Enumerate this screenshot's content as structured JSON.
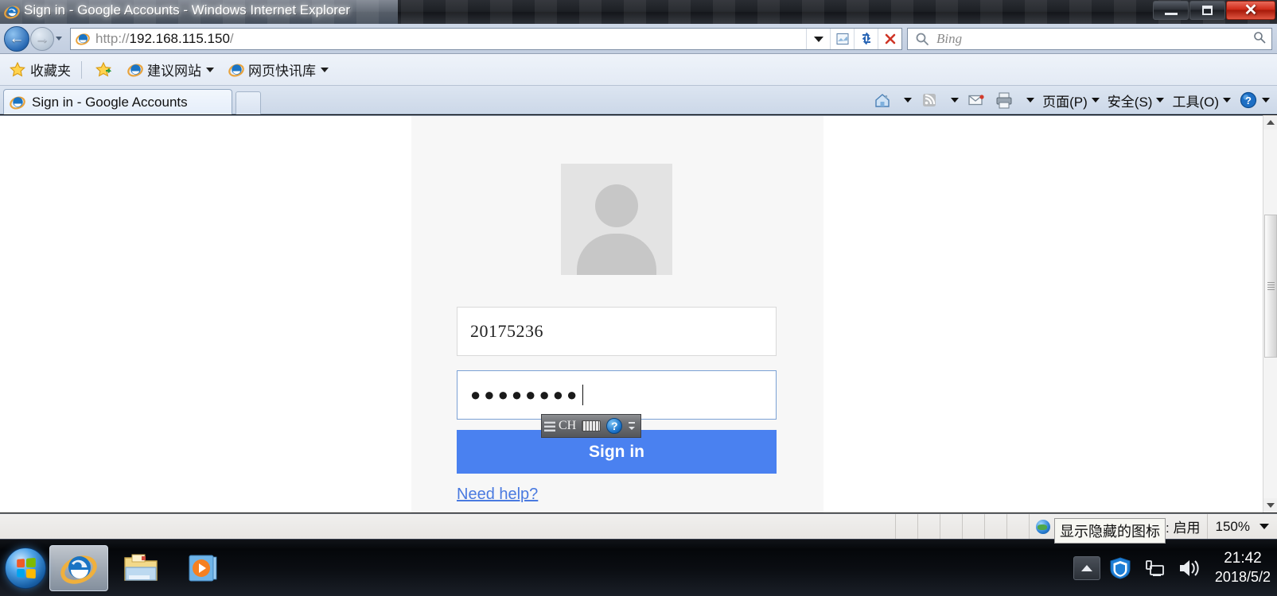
{
  "window": {
    "title": "Sign in - Google Accounts - Windows Internet Explorer",
    "minimize_label": "",
    "maximize_label": "",
    "close_label": "✕"
  },
  "navbar": {
    "back_label": "←",
    "forward_label": "→",
    "url_protocol": "http://",
    "url_host": "192.168.115.150",
    "url_trail": "/",
    "search_placeholder": "Bing",
    "compat_icon": "compatibility-view-icon",
    "refresh_icon": "refresh-icon",
    "stop_icon": "stop-icon"
  },
  "favorites_bar": {
    "favorites_label": "收藏夹",
    "items": [
      {
        "label": "建议网站",
        "has_caret": true
      },
      {
        "label": "网页快讯库",
        "has_caret": true
      }
    ]
  },
  "tabs": {
    "active_tab_label": "Sign in - Google Accounts",
    "new_tab_label": ""
  },
  "command_bar": {
    "items": [
      {
        "label": "",
        "icon": "home-icon",
        "caret": true
      },
      {
        "label": "",
        "icon": "rss-feed-icon",
        "caret": true
      },
      {
        "label": "",
        "icon": "mail-icon",
        "caret": false
      },
      {
        "label": "",
        "icon": "printer-icon",
        "caret": true
      },
      {
        "label": "页面(P)",
        "icon": "",
        "caret": true
      },
      {
        "label": "安全(S)",
        "icon": "",
        "caret": true
      },
      {
        "label": "工具(O)",
        "icon": "",
        "caret": true
      },
      {
        "label": "",
        "icon": "help-icon",
        "caret": true
      }
    ]
  },
  "page": {
    "avatar_alt": "default-user-avatar",
    "username_value": "20175236",
    "username_placeholder": "",
    "password_value": "●●●●●●●●",
    "password_placeholder": "",
    "signin_label": "Sign in",
    "need_help_label": "Need help?",
    "accent_color": "#4a81f0",
    "link_color": "#4a7ae0",
    "panel_color": "#f7f7f7"
  },
  "ime_bar": {
    "language_label": "CH",
    "keyboard_icon": "keyboard-icon",
    "help_label": "?",
    "grip_icon": "drag-grip-icon"
  },
  "status_bar": {
    "zone_text": "Internet | 保护模式: 启用",
    "zoom_level": "150%"
  },
  "tray_tooltip": {
    "text": "显示隐藏的图标"
  },
  "taskbar": {
    "start_label": "start-orb",
    "buttons": [
      {
        "name": "internet-explorer",
        "active": true
      },
      {
        "name": "windows-explorer",
        "active": false
      },
      {
        "name": "windows-media-player",
        "active": false
      }
    ],
    "tray_icons": [
      "show-hidden-icons",
      "security-shield",
      "network",
      "volume"
    ],
    "clock_time": "21:42",
    "clock_date": "2018/5/2"
  }
}
